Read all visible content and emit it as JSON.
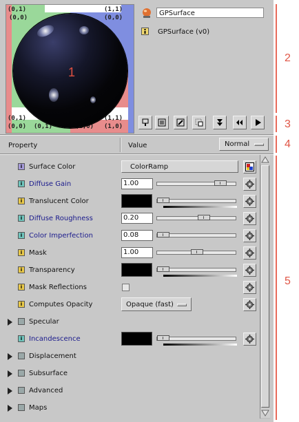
{
  "preview": {
    "sphere_label": "1",
    "coord_labels": [
      "(0,1)",
      "(0,0)",
      "(1,1)",
      "(0,0)",
      "(0,1)",
      "(1,1)",
      "(0,0)",
      "(1,0)",
      "(0,1)",
      "(1,0)"
    ]
  },
  "header": {
    "shader_name": "GPSurface",
    "shader_version": "GPSurface (v0)"
  },
  "toolbar": {
    "buttons": [
      "pin-menu",
      "list-view",
      "pick",
      "multi-select",
      "collapse",
      "back",
      "play"
    ]
  },
  "columns": {
    "property": "Property",
    "value": "Value"
  },
  "mode_select": {
    "value": "Normal"
  },
  "rows": [
    {
      "label": "Surface Color",
      "kind": "ramp",
      "value": "ColorRamp",
      "blue": false
    },
    {
      "label": "Diffuse Gain",
      "kind": "float",
      "value": "1.00",
      "slider": 0.85,
      "blue": true
    },
    {
      "label": "Translucent Color",
      "kind": "color",
      "color": "#000000",
      "slider": 0.0,
      "blue": false
    },
    {
      "label": "Diffuse Roughness",
      "kind": "float",
      "value": "0.20",
      "slider": 0.6,
      "blue": true
    },
    {
      "label": "Color Imperfection",
      "kind": "float",
      "value": "0.08",
      "slider": 0.0,
      "blue": true
    },
    {
      "label": "Mask",
      "kind": "float",
      "value": "1.00",
      "slider": 0.5,
      "blue": false
    },
    {
      "label": "Transparency",
      "kind": "color",
      "color": "#000000",
      "slider": 0.0,
      "blue": false
    },
    {
      "label": "Mask Reflections",
      "kind": "checkbox",
      "checked": false,
      "blue": false
    },
    {
      "label": "Computes Opacity",
      "kind": "select",
      "value": "Opaque (fast)",
      "blue": false
    },
    {
      "label": "Specular",
      "kind": "group"
    },
    {
      "label": "Incandescence",
      "kind": "color",
      "color": "#000000",
      "slider": 0.0,
      "blue": true
    },
    {
      "label": "Displacement",
      "kind": "group"
    },
    {
      "label": "Subsurface",
      "kind": "group"
    },
    {
      "label": "Advanced",
      "kind": "group"
    },
    {
      "label": "Maps",
      "kind": "group"
    }
  ],
  "annotations": [
    "2",
    "3",
    "4",
    "5"
  ],
  "colors": {
    "panel": "#c8c8c8",
    "annotation": "#e96a5a",
    "label_blue": "#1a1a8c",
    "param_icon_yellow": "#e8c84a",
    "param_icon_teal": "#6fc4bc",
    "param_icon_purple": "#a59ad8"
  }
}
